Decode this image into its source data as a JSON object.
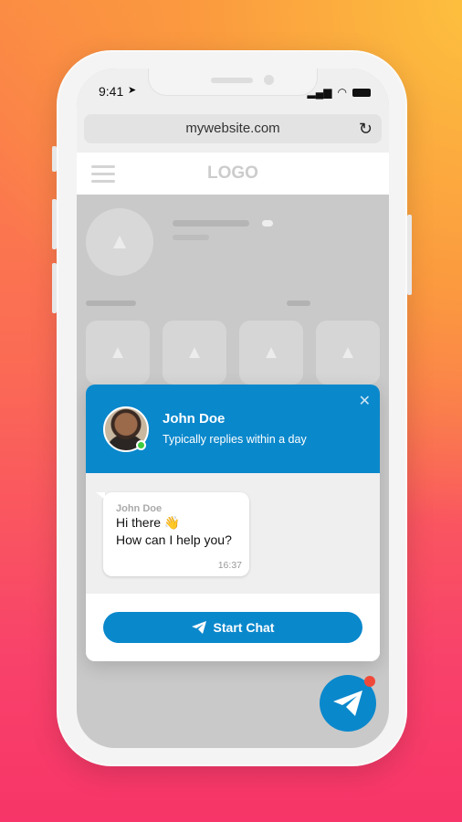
{
  "status_bar": {
    "time": "9:41"
  },
  "browser": {
    "url": "mywebsite.com"
  },
  "site": {
    "logo": "LOGO"
  },
  "chat_widget": {
    "agent_name": "John Doe",
    "agent_status": "Typically replies within a day",
    "message": {
      "sender": "John Doe",
      "line1": "Hi there 👋",
      "line2": "How can I help you?",
      "time": "16:37"
    },
    "start_chat_label": "Start Chat",
    "colors": {
      "accent": "#0a88cc",
      "online": "#3fcd3f",
      "notification": "#f0493a"
    }
  }
}
